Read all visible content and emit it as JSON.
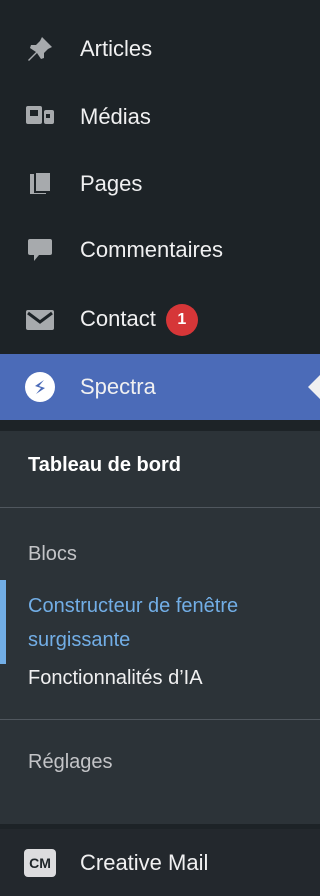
{
  "menu": {
    "items": [
      {
        "label": "Articles",
        "icon": "pin-icon"
      },
      {
        "label": "Médias",
        "icon": "media-icon"
      },
      {
        "label": "Pages",
        "icon": "pages-icon"
      },
      {
        "label": "Commentaires",
        "icon": "comment-icon"
      },
      {
        "label": "Contact",
        "icon": "mail-icon",
        "badge": "1"
      },
      {
        "label": "Spectra",
        "icon": "spectra-icon"
      }
    ],
    "submenu": {
      "dashboard": "Tableau de bord",
      "blocks": "Blocs",
      "popup_builder": "Constructeur de fenêtre surgissante",
      "ai_features": "Fonctionnalités d’IA",
      "settings": "Réglages"
    },
    "creative_mail": {
      "label": "Creative Mail",
      "icon_text": "CM"
    }
  },
  "colors": {
    "sidebar_bg": "#1d2327",
    "submenu_bg": "#2c3338",
    "active_bg": "#4b6bb8",
    "current_link": "#72aee6",
    "badge_bg": "#d63638"
  }
}
